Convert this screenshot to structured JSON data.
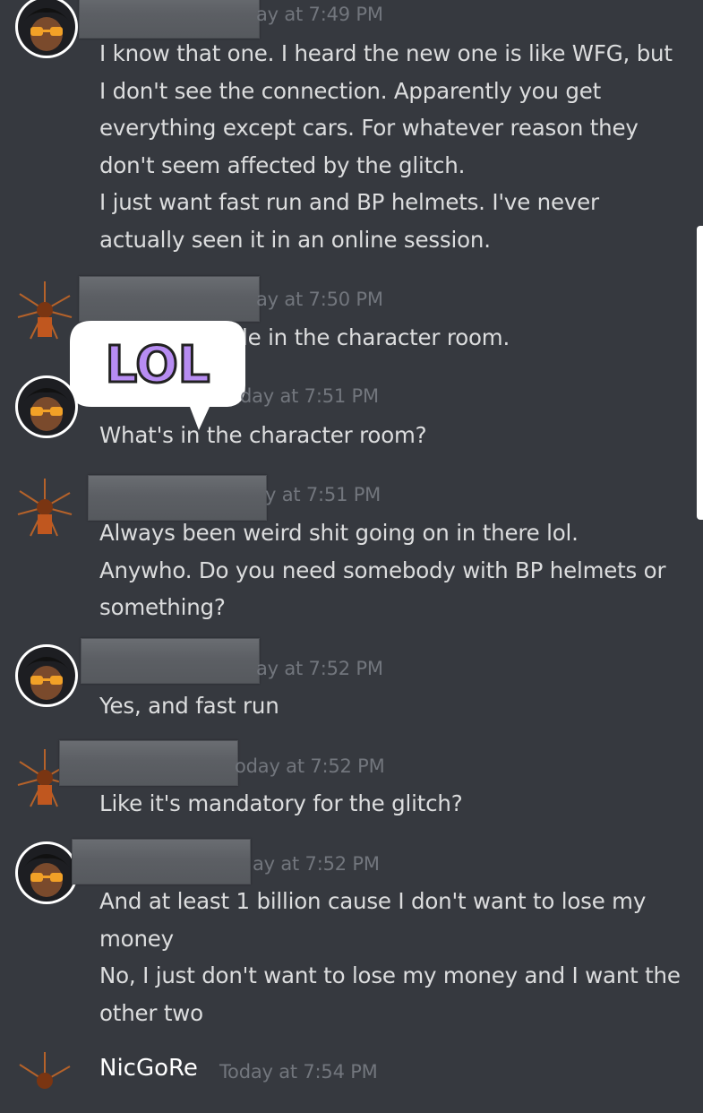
{
  "messages": [
    {
      "author_visible": "",
      "timestamp": "ay at 7:49 PM",
      "lines": [
        "I know that one. I heard the new one is like WFG, but",
        "I don't see the connection. Apparently you get",
        "everything except cars. For whatever reason they",
        "don't seem affected by the glitch.",
        "I just want fast run and BP helmets. I've never",
        "actually seen it in an online session."
      ]
    },
    {
      "author_visible": "",
      "timestamp": "ay at 7:50 PM",
      "lines": [
        "le in the character room."
      ]
    },
    {
      "author_visible": "",
      "timestamp": "day at 7:51 PM",
      "lines": [
        "What's in the character room?"
      ]
    },
    {
      "author_visible": "",
      "timestamp": "y at 7:51 PM",
      "lines": [
        "Always been weird shit going on in there lol.",
        "Anywho. Do you need somebody with BP helmets or",
        "something?"
      ]
    },
    {
      "author_visible": "",
      "timestamp": "ay at 7:52 PM",
      "lines": [
        "Yes, and fast run"
      ]
    },
    {
      "author_visible": "",
      "timestamp": "oday at 7:52 PM",
      "lines": [
        "Like it's mandatory for the glitch?"
      ]
    },
    {
      "author_visible": "",
      "timestamp": "ay at 7:52 PM",
      "lines": [
        "And at least 1 billion cause I don't want to lose my",
        "money",
        "No, I just don't want to lose my money and I want the",
        "other two"
      ]
    },
    {
      "author_visible": "NicGoRe",
      "timestamp": "Today at 7:54 PM",
      "lines": []
    }
  ],
  "sticker": {
    "text": "LOL",
    "fill_color": "#b78cf2",
    "accent_color": "#7ee3a6"
  },
  "colors": {
    "background": "#36393f",
    "text": "#dcddde",
    "timestamp": "#72767d"
  }
}
